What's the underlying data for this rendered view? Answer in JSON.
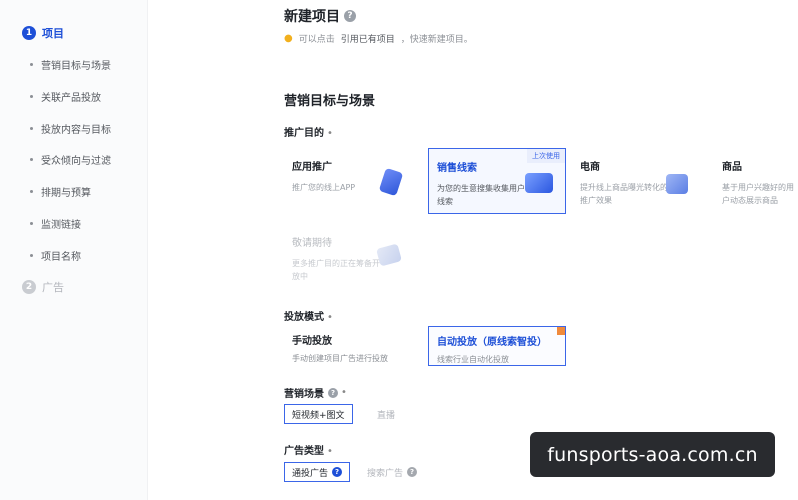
{
  "sidebar": {
    "steps": [
      {
        "num": "1",
        "label": "项目"
      },
      {
        "num": "2",
        "label": "广告"
      }
    ],
    "items": [
      {
        "label": "营销目标与场景"
      },
      {
        "label": "关联产品投放"
      },
      {
        "label": "投放内容与目标"
      },
      {
        "label": "受众倾向与过滤"
      },
      {
        "label": "排期与预算"
      },
      {
        "label": "监测链接"
      },
      {
        "label": "项目名称"
      }
    ]
  },
  "header": {
    "title": "新建项目",
    "help": "?",
    "tip_prefix": "可以点击",
    "tip_link": "引用已有项目",
    "tip_suffix": "，快速新建项目。"
  },
  "section": {
    "title": "营销目标与场景"
  },
  "promotion": {
    "label": "推广目的",
    "required": "•",
    "cards": [
      {
        "title": "应用推广",
        "desc": "推广您的线上APP"
      },
      {
        "title": "销售线索",
        "desc": "为您的生意搜集收集用户线索",
        "badge": "上次使用"
      },
      {
        "title": "电商",
        "desc": "提升线上商品曝光转化的推广效果"
      },
      {
        "title": "商品",
        "desc": "基于用户兴趣好的用户动态展示商品"
      },
      {
        "title": "敬请期待",
        "desc": "更多推广目的正在筹备开放中"
      }
    ]
  },
  "delivery": {
    "label": "投放模式",
    "required": "•",
    "modes": [
      {
        "title": "手动投放",
        "desc": "手动创建项目广告进行投放"
      },
      {
        "title": "自动投放（原线索智投）",
        "desc": "线索行业自动化投放"
      }
    ]
  },
  "scene": {
    "label": "营销场景",
    "required": "•",
    "help": "?",
    "options": [
      {
        "label": "短视频+图文"
      },
      {
        "label": "直播"
      }
    ]
  },
  "adtype": {
    "label": "广告类型",
    "required": "•",
    "options": [
      {
        "label": "通投广告",
        "help": "?"
      },
      {
        "label": "搜索广告",
        "help": "?"
      }
    ]
  },
  "watermark": {
    "text": "funsports-aoa.com.cn"
  },
  "colors": {
    "accent": "#1d4fd7",
    "selected_border": "#3b66e8",
    "badge_bg": "#e9eefc"
  },
  "icons": {
    "tip": "lightbulb-icon",
    "help": "question-circle-icon"
  }
}
